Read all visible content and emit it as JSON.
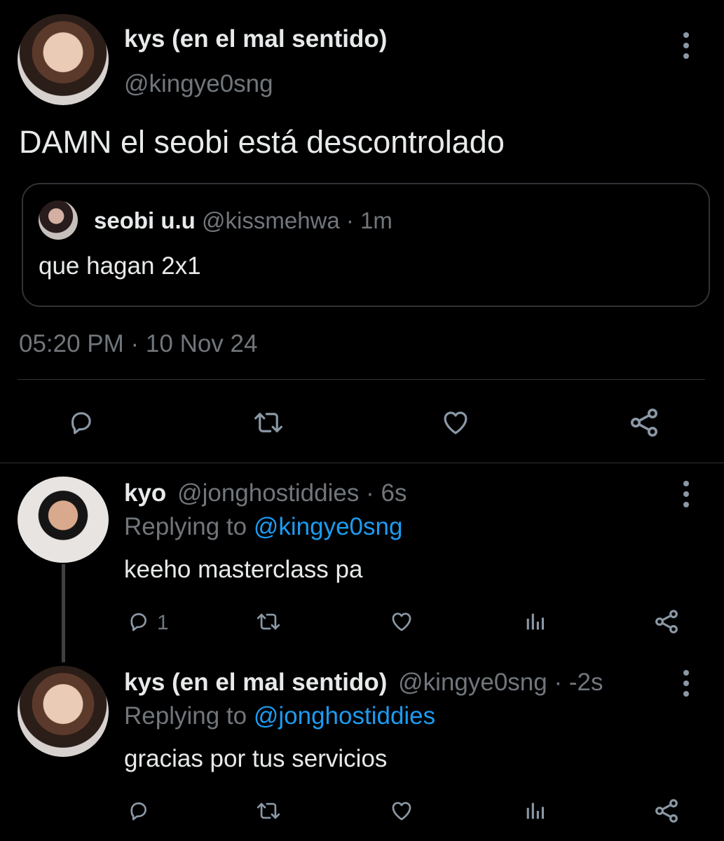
{
  "main_tweet": {
    "author_name": "kys (en el mal sentido)",
    "handle": "@kingye0sng",
    "text": "DAMN el seobi está descontrolado",
    "timestamp": "05:20 PM · 10 Nov 24",
    "quoted": {
      "author_name": "seobi u.u",
      "handle": "@kissmehwa",
      "time": "· 1m",
      "text": "que hagan 2x1"
    }
  },
  "replies": [
    {
      "author_name": "kyo",
      "handle": "@jonghostiddies",
      "time": "· 6s",
      "replying_prefix": "Replying to",
      "replying_to": "@kingye0sng",
      "text": "keeho masterclass pa",
      "reply_count": "1"
    },
    {
      "author_name": "kys (en el mal sentido)",
      "handle": "@kingye0sng",
      "time": "· -2s",
      "replying_prefix": "Replying to",
      "replying_to": "@jonghostiddies",
      "text": "gracias por tus servicios",
      "reply_count": ""
    }
  ],
  "icons": [
    "reply-icon",
    "retweet-icon",
    "like-icon",
    "share-icon",
    "views-icon",
    "more-icon"
  ],
  "colors": {
    "background": "#000000",
    "text": "#e7e9ea",
    "muted": "#71767b",
    "link": "#1d9bf0"
  }
}
